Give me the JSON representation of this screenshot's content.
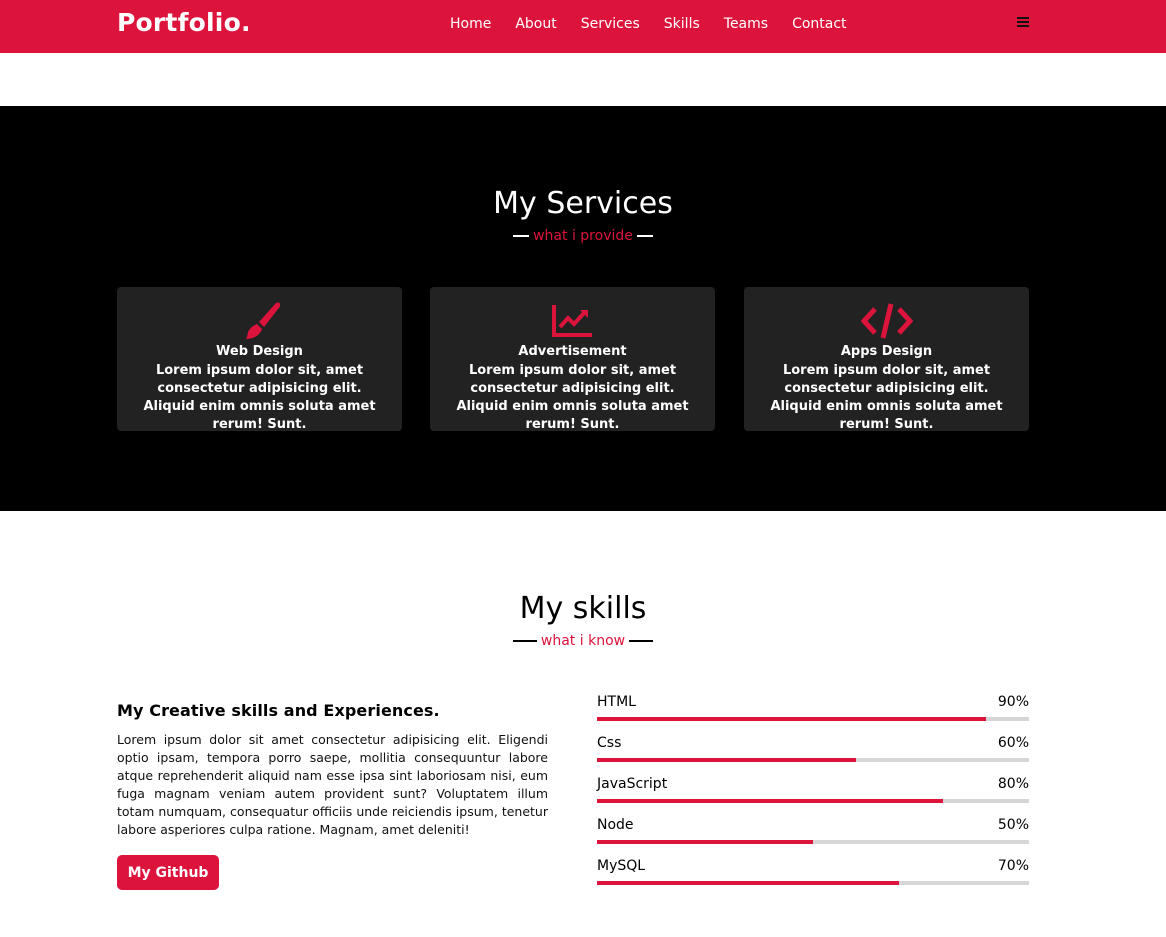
{
  "nav": {
    "logo": "Portfolio.",
    "items": [
      "Home",
      "About",
      "Services",
      "Skills",
      "Teams",
      "Contact"
    ],
    "menu_icon": "bars-icon"
  },
  "services": {
    "title": "My Services",
    "subtitle": "what i provide",
    "cards": [
      {
        "icon": "paint-brush-icon",
        "title": "Web Design",
        "text": "Lorem ipsum dolor sit, amet consectetur adipisicing elit. Aliquid enim omnis soluta amet rerum! Sunt."
      },
      {
        "icon": "chart-line-icon",
        "title": "Advertisement",
        "text": "Lorem ipsum dolor sit, amet consectetur adipisicing elit. Aliquid enim omnis soluta amet rerum! Sunt."
      },
      {
        "icon": "code-icon",
        "title": "Apps Design",
        "text": "Lorem ipsum dolor sit, amet consectetur adipisicing elit. Aliquid enim omnis soluta amet rerum! Sunt."
      }
    ]
  },
  "skills": {
    "title": "My skills",
    "subtitle": "what i know",
    "heading": "My Creative skills and Experiences.",
    "paragraph": "Lorem ipsum dolor sit amet consectetur adipisicing elit. Eligendi optio ipsam, tempora porro saepe, mollitia consequuntur labore atque reprehenderit aliquid nam esse ipsa sint laboriosam nisi, eum fuga magnam veniam autem provident sunt? Voluptatem illum totam numquam, consequatur officiis unde reiciendis ipsum, tenetur labore asperiores culpa ratione. Magnam, amet deleniti!",
    "button": "My Github",
    "bars": [
      {
        "name": "HTML",
        "label": "90%",
        "value": 90
      },
      {
        "name": "Css",
        "label": "60%",
        "value": 60
      },
      {
        "name": "JavaScript",
        "label": "80%",
        "value": 80
      },
      {
        "name": "Node",
        "label": "50%",
        "value": 50
      },
      {
        "name": "MySQL",
        "label": "70%",
        "value": 70
      }
    ]
  },
  "colors": {
    "accent": "#dc143c",
    "dark": "#000000",
    "card": "#222222",
    "track": "#d6d6d6"
  }
}
